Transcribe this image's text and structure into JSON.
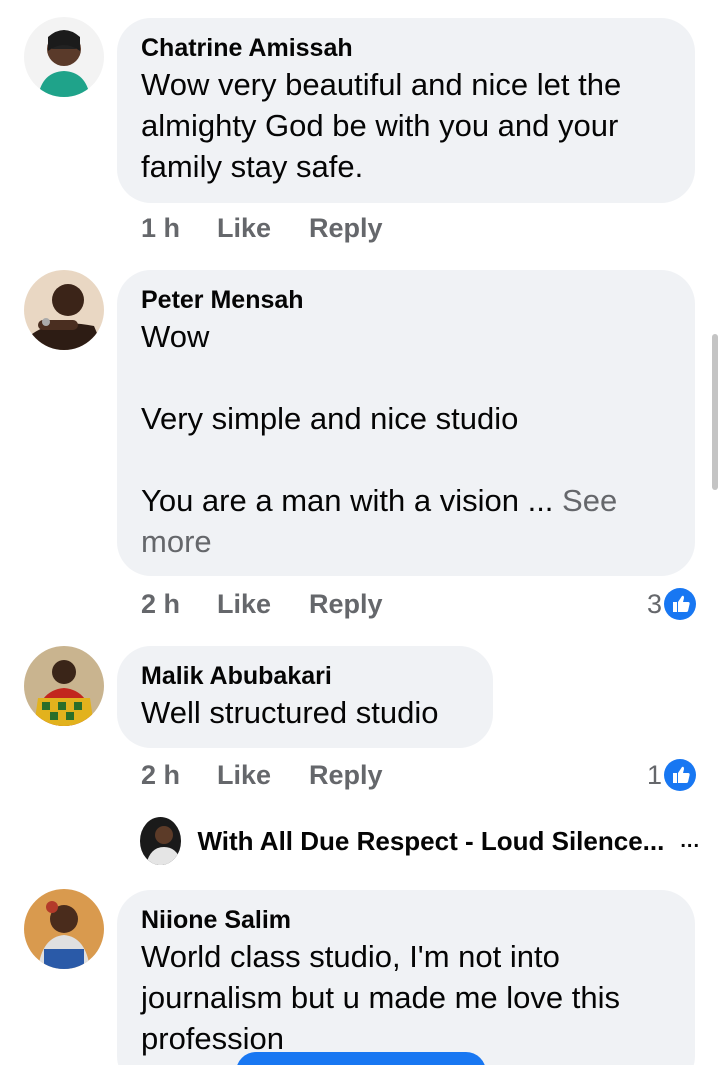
{
  "comments": [
    {
      "name": "Chatrine Amissah",
      "text": "Wow very beautiful and nice let the almighty God be with you and your family stay safe.",
      "time": "1 h",
      "like_label": "Like",
      "reply_label": "Reply"
    },
    {
      "name": "Peter Mensah",
      "text": "Wow\n\nVery simple and nice studio\n\nYou are a man with a vision ...",
      "see_more": "See more",
      "time": "2 h",
      "like_label": "Like",
      "reply_label": "Reply",
      "reaction_count": "3"
    },
    {
      "name": "Malik Abubakari",
      "text": "Well structured studio",
      "time": "2 h",
      "like_label": "Like",
      "reply_label": "Reply",
      "reaction_count": "1",
      "reply_preview": {
        "title": "With All Due Respect - Loud Silence...",
        "more": "..."
      }
    },
    {
      "name": "Niione Salim",
      "text": "World class studio, I'm not  into journalism but u made me love this profession"
    }
  ],
  "icons": {
    "reaction": "like-thumb-icon",
    "more": "more-dots-icon"
  },
  "colors": {
    "bubble": "#f0f2f5",
    "meta_text": "#65676b",
    "like_blue": "#1877f2"
  }
}
